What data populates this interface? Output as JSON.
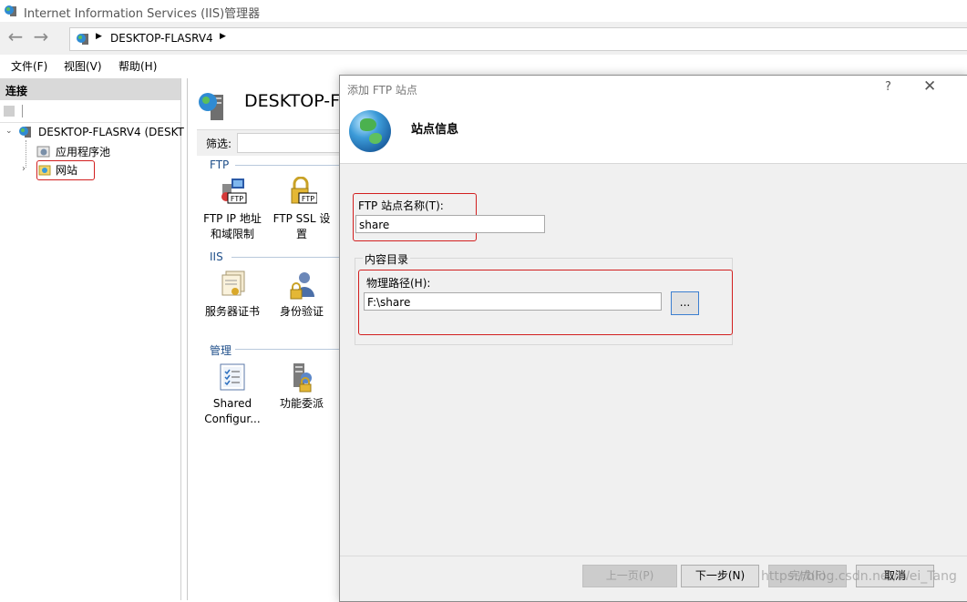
{
  "window": {
    "title": "Internet Information Services (IIS)管理器"
  },
  "address": {
    "path": "DESKTOP-FLASRV4"
  },
  "menu": {
    "items": [
      "文件(F)",
      "视图(V)",
      "帮助(H)"
    ]
  },
  "connections": {
    "header": "连接",
    "server": "DESKTOP-FLASRV4 (DESKT",
    "app_pools": "应用程序池",
    "sites": "网站"
  },
  "center": {
    "title": "DESKTOP-FL",
    "filter_label": "筛选:",
    "groups": {
      "ftp": "FTP",
      "iis": "IIS",
      "manage": "管理"
    },
    "features": {
      "ftp_ip": [
        "FTP IP 地址",
        "和域限制"
      ],
      "ftp_ssl": [
        "FTP SSL 设",
        "置"
      ],
      "server_cert": [
        "服务器证书"
      ],
      "auth": [
        "身份验证"
      ],
      "shared_config": [
        "Shared",
        "Configur..."
      ],
      "feature_delegation": [
        "功能委派"
      ]
    },
    "icon_badge": "FTP"
  },
  "dialog": {
    "title": "添加 FTP 站点",
    "help": "?",
    "close": "✕",
    "section_title": "站点信息",
    "site_name_label": "FTP 站点名称(T):",
    "site_name_value": "share",
    "content_dir_label": "内容目录",
    "physical_path_label": "物理路径(H):",
    "physical_path_value": "F:\\share",
    "browse_label": "...",
    "buttons": {
      "prev": "上一页(P)",
      "next": "下一步(N)",
      "finish": "完成(F)",
      "cancel": "取消"
    }
  },
  "watermark": "https://blog.csdn.net/Wei_Tang"
}
